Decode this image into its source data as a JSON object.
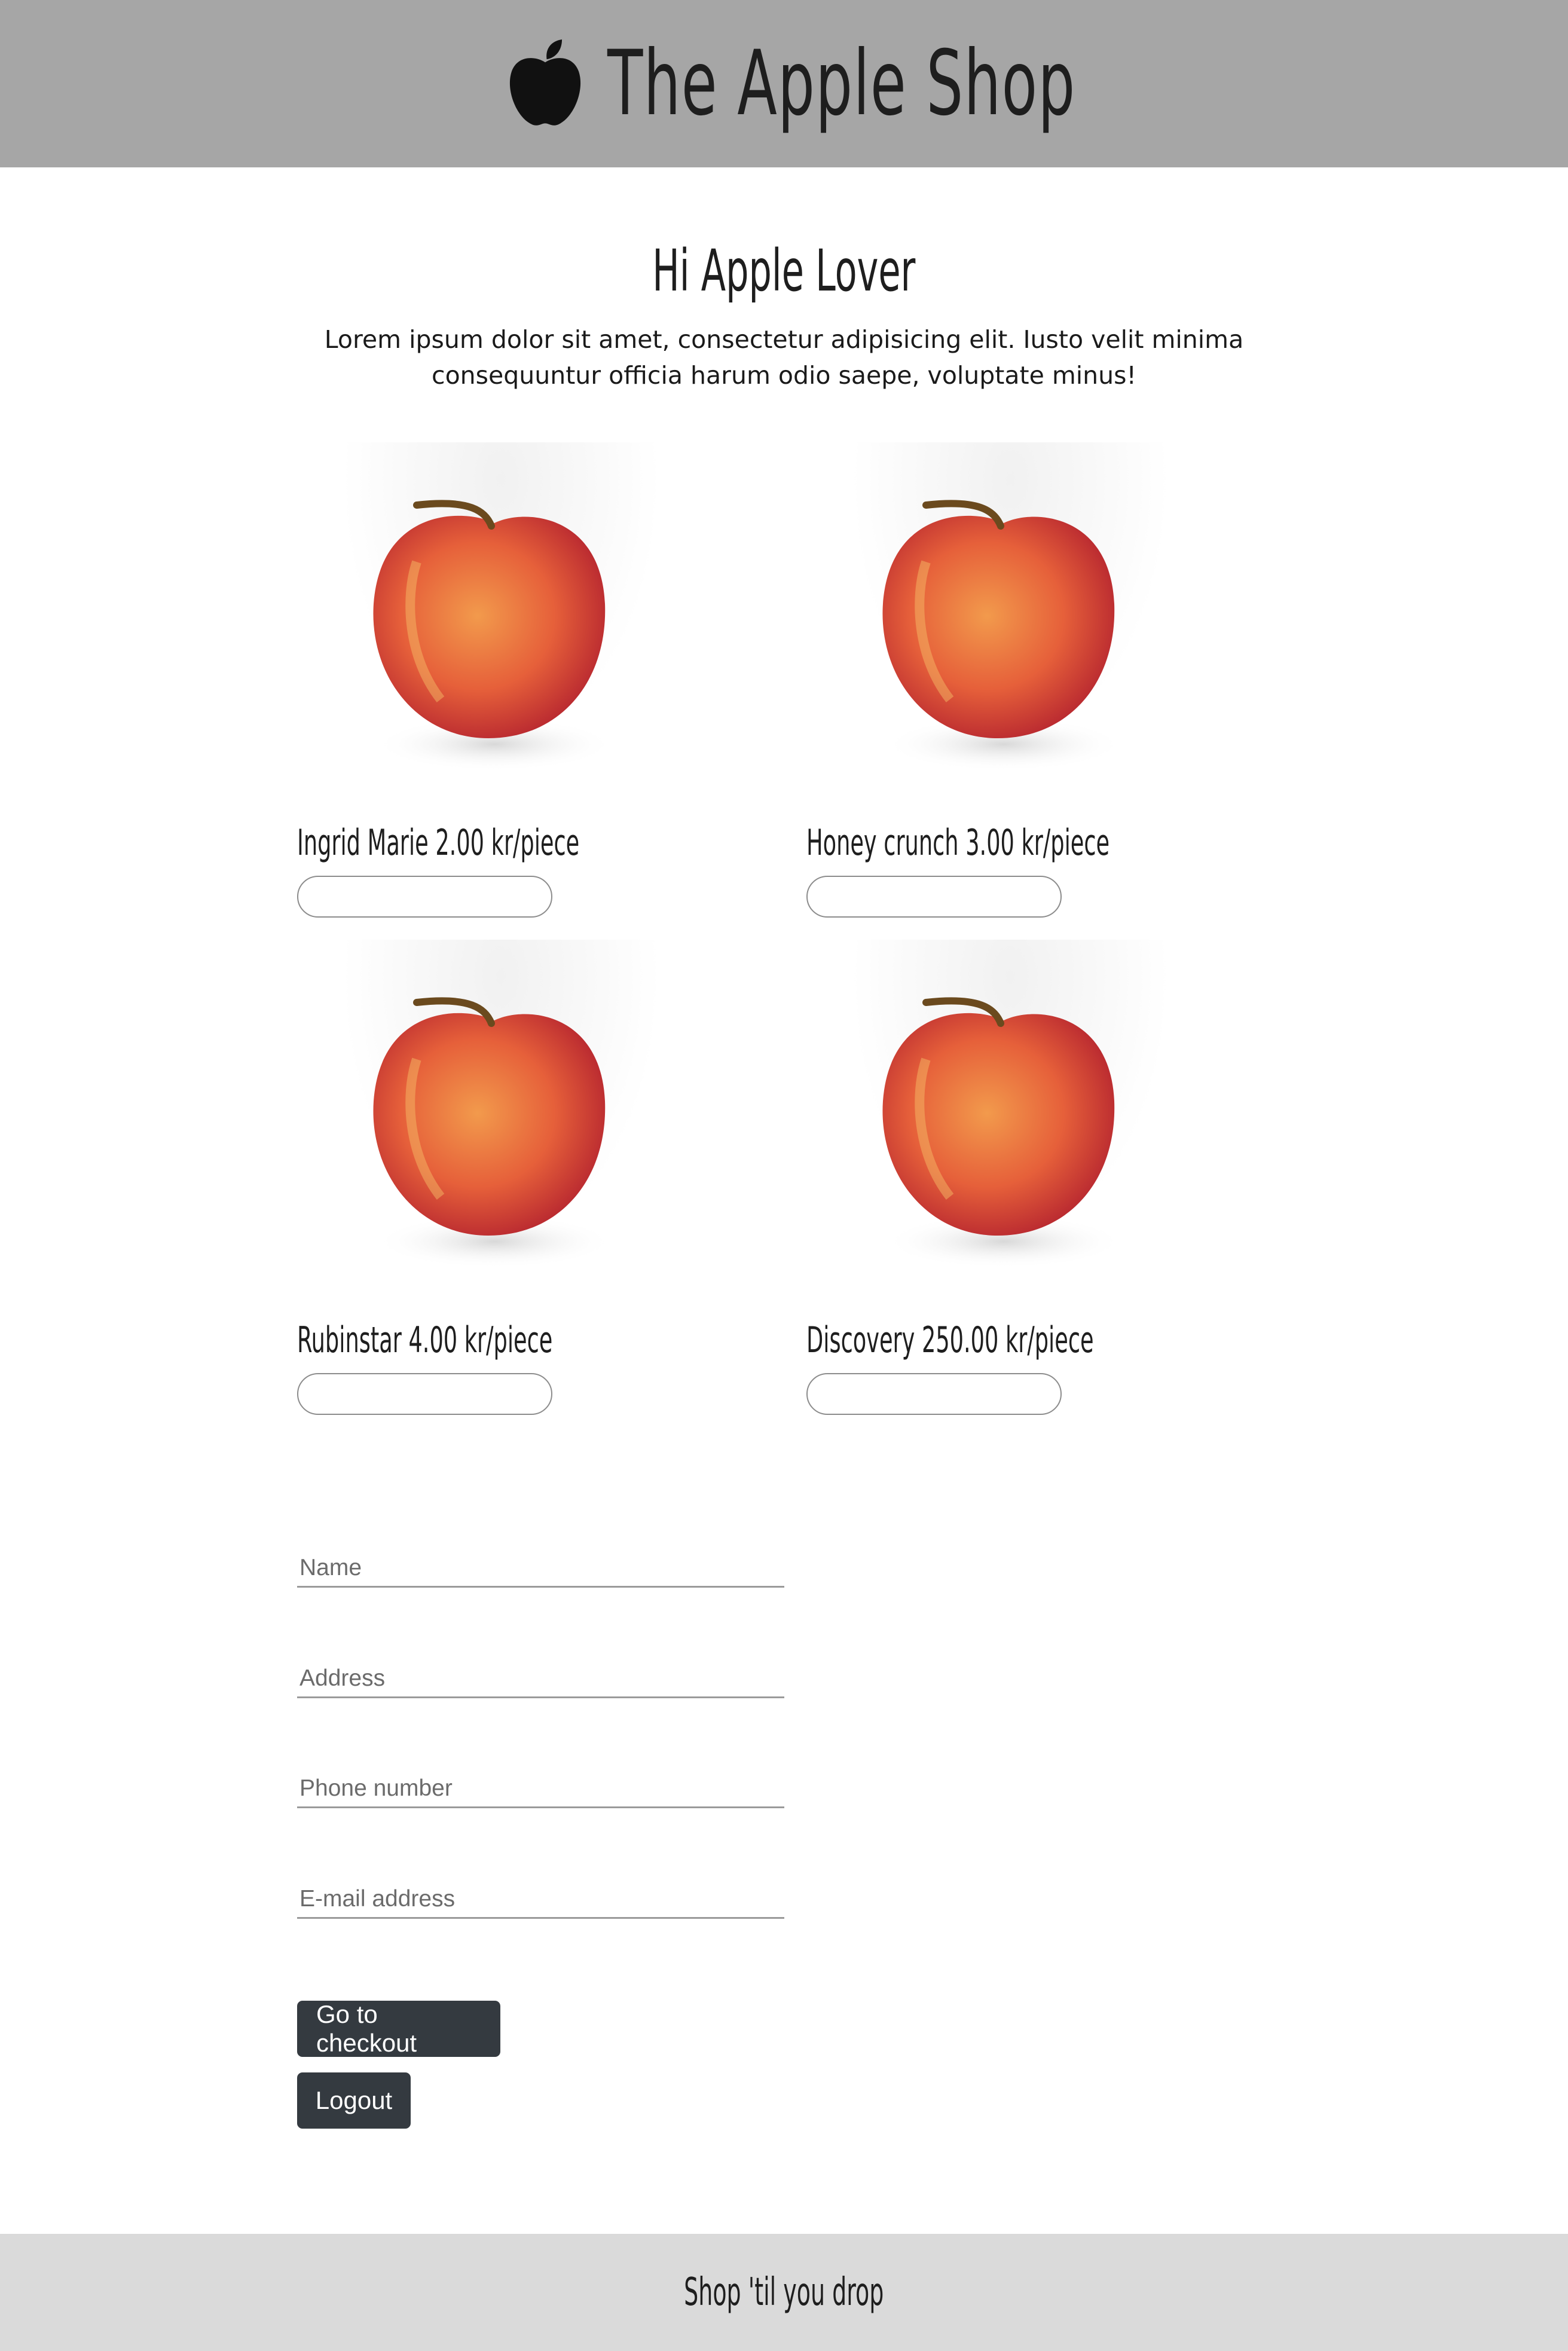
{
  "header": {
    "logo_icon": "apple-logo-icon",
    "title": "The Apple Shop",
    "background": "#a6a6a6"
  },
  "main": {
    "greeting": "Hi Apple Lover",
    "intro": "Lorem ipsum dolor sit amet, consectetur adipisicing elit. Iusto velit minima consequuntur officia harum odio saepe, voluptate minus!"
  },
  "products": [
    {
      "name": "Ingrid Marie",
      "price": "2.00",
      "unit": "kr/piece",
      "label": "Ingrid Marie 2.00 kr/piece",
      "quantity": ""
    },
    {
      "name": "Honey crunch",
      "price": "3.00",
      "unit": "kr/piece",
      "label": "Honey crunch 3.00 kr/piece",
      "quantity": ""
    },
    {
      "name": "Rubinstar",
      "price": "4.00",
      "unit": "kr/piece",
      "label": "Rubinstar 4.00 kr/piece",
      "quantity": ""
    },
    {
      "name": "Discovery",
      "price": "250.00",
      "unit": "kr/piece",
      "label": "Discovery 250.00 kr/piece",
      "quantity": ""
    }
  ],
  "form": {
    "name_placeholder": "Name",
    "address_placeholder": "Address",
    "phone_placeholder": "Phone number",
    "email_placeholder": "E-mail address"
  },
  "buttons": {
    "checkout_label": "Go to checkout",
    "logout_label": "Logout",
    "color": "#343a40"
  },
  "footer": {
    "text": "Shop 'til you drop",
    "background": "#dadada"
  }
}
